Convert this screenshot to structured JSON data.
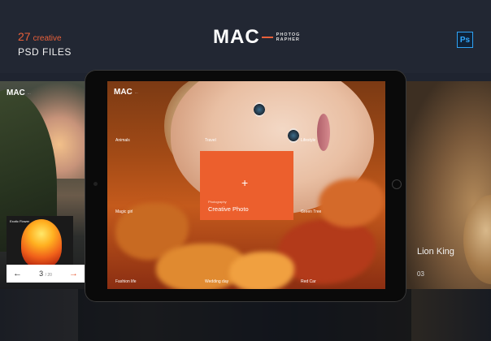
{
  "header": {
    "promo_number": "27",
    "promo_word": "creative",
    "promo_line2": "PSD FILES",
    "brand_big": "MAC",
    "brand_small_1": "PHOTOG",
    "brand_small_2": "RAPHER",
    "ps_badge": "Ps"
  },
  "left_panel": {
    "logo": "MAC",
    "flower_label": "Exotic Flower",
    "pager_current": "3",
    "pager_total": "/ 20",
    "prev_arrow": "←",
    "next_arrow": "→"
  },
  "tablet": {
    "logo": "MAC",
    "grid_labels": [
      "Animals",
      "Travel",
      "Lifestyle",
      "Magic girl",
      "Green Tree",
      "Fashion life",
      "Wedding day",
      "Red Car"
    ],
    "card": {
      "plus": "+",
      "subtitle": "Photography",
      "title": "Creative Photo"
    }
  },
  "right_panel": {
    "title": "Lion King",
    "number": "03"
  },
  "colors": {
    "accent": "#ec5f2d",
    "background": "#1f2430",
    "ps_blue": "#31a8ff"
  }
}
